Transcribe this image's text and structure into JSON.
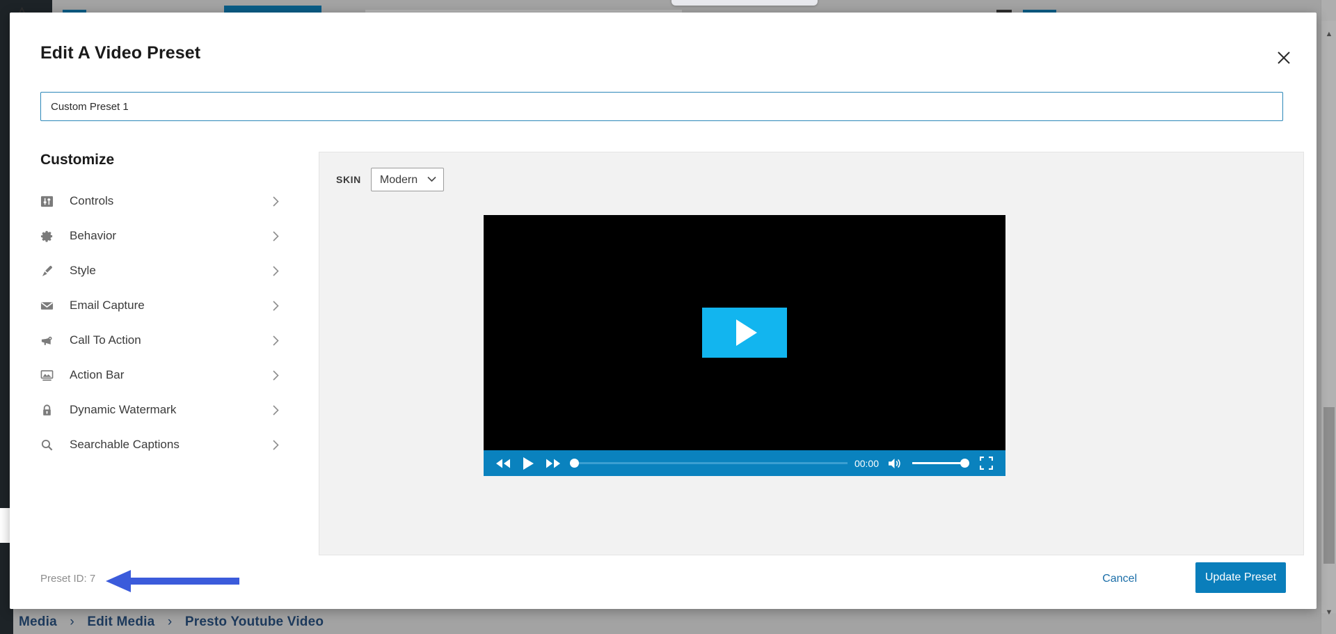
{
  "backdrop": {
    "breadcrumb": {
      "items": [
        "Media",
        "Edit Media",
        "Presto Youtube Video"
      ],
      "separator": "›"
    }
  },
  "modal": {
    "title": "Edit A Video Preset",
    "close_icon": "close-icon",
    "preset_name": {
      "value": "Custom Preset 1",
      "placeholder": "Preset Name"
    },
    "customize": {
      "heading": "Customize",
      "items": [
        {
          "label": "Controls",
          "icon": "sliders-icon",
          "chevron": "chevron-right-icon"
        },
        {
          "label": "Behavior",
          "icon": "gear-icon",
          "chevron": "chevron-right-icon"
        },
        {
          "label": "Style",
          "icon": "paintbrush-icon",
          "chevron": "chevron-right-icon"
        },
        {
          "label": "Email Capture",
          "icon": "envelope-icon",
          "chevron": "chevron-right-icon"
        },
        {
          "label": "Call To Action",
          "icon": "megaphone-icon",
          "chevron": "chevron-right-icon"
        },
        {
          "label": "Action Bar",
          "icon": "image-bar-icon",
          "chevron": "chevron-right-icon"
        },
        {
          "label": "Dynamic Watermark",
          "icon": "lock-icon",
          "chevron": "chevron-right-icon"
        },
        {
          "label": "Searchable Captions",
          "icon": "search-icon",
          "chevron": "chevron-right-icon"
        }
      ]
    },
    "preview": {
      "skin_label": "SKIN",
      "skin_value": "Modern",
      "skin_options": [
        "Modern"
      ],
      "player": {
        "big_play_icon": "play-icon",
        "controls": {
          "rewind_icon": "rewind-icon",
          "play_icon": "play-icon",
          "forward_icon": "fast-forward-icon",
          "time": "00:00",
          "volume_icon": "volume-high-icon",
          "fullscreen_icon": "fullscreen-icon",
          "progress_percent": 0,
          "volume_percent": 100
        },
        "accent_color": "#0a82be",
        "play_button_color": "#12b5ef"
      }
    },
    "footer": {
      "preset_id_label": "Preset ID: 7",
      "cancel_label": "Cancel",
      "update_label": "Update Preset",
      "annotation_arrow": "left-arrow-annotation",
      "annotation_color": "#3b5bdb"
    }
  }
}
